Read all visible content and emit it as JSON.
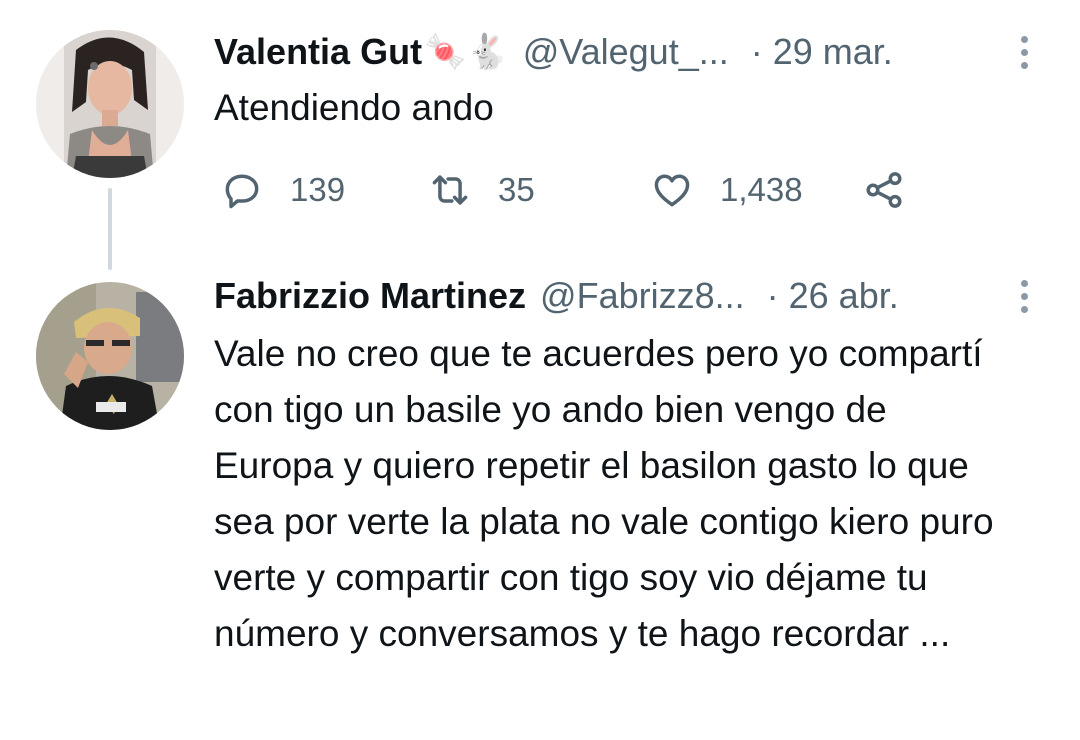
{
  "tweets": [
    {
      "author_name": "Valentia Gut",
      "author_emoji": "🍬🐇",
      "author_handle": "@Valegut_...",
      "separator": "·",
      "date": "29 mar.",
      "text": "Atendiendo ando",
      "actions": {
        "replies": "139",
        "retweets": "35",
        "likes": "1,438"
      }
    },
    {
      "author_name": "Fabrizzio Martinez",
      "author_handle": "@Fabrizz8...",
      "separator": "·",
      "date": "26 abr.",
      "text": "Vale no creo que te acuerdes pero yo compartí con tigo un basile yo ando bien vengo de Europa y quiero repetir el basilon gasto lo que sea por verte la plata no vale contigo kiero puro verte y compartir con tigo soy vio déjame tu número y conversamos y te hago recordar ..."
    }
  ],
  "icons": {
    "reply": "comment-icon",
    "retweet": "retweet-icon",
    "like": "heart-icon",
    "share": "share-icon",
    "more": "more-vertical-icon"
  },
  "colors": {
    "text": "#0f1419",
    "secondary": "#536471",
    "thread_line": "#cfd9de"
  }
}
